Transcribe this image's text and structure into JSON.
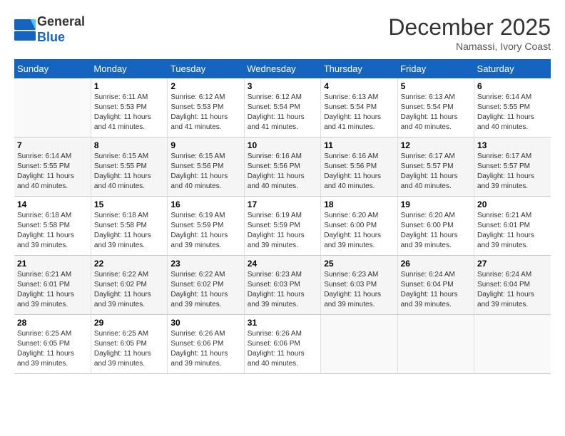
{
  "header": {
    "logo_line1": "General",
    "logo_line2": "Blue",
    "month": "December 2025",
    "location": "Namassi, Ivory Coast"
  },
  "weekdays": [
    "Sunday",
    "Monday",
    "Tuesday",
    "Wednesday",
    "Thursday",
    "Friday",
    "Saturday"
  ],
  "weeks": [
    [
      {
        "day": "",
        "sunrise": "",
        "sunset": "",
        "daylight": "",
        "empty": true
      },
      {
        "day": "1",
        "sunrise": "Sunrise: 6:11 AM",
        "sunset": "Sunset: 5:53 PM",
        "daylight": "Daylight: 11 hours and 41 minutes.",
        "empty": false
      },
      {
        "day": "2",
        "sunrise": "Sunrise: 6:12 AM",
        "sunset": "Sunset: 5:53 PM",
        "daylight": "Daylight: 11 hours and 41 minutes.",
        "empty": false
      },
      {
        "day": "3",
        "sunrise": "Sunrise: 6:12 AM",
        "sunset": "Sunset: 5:54 PM",
        "daylight": "Daylight: 11 hours and 41 minutes.",
        "empty": false
      },
      {
        "day": "4",
        "sunrise": "Sunrise: 6:13 AM",
        "sunset": "Sunset: 5:54 PM",
        "daylight": "Daylight: 11 hours and 41 minutes.",
        "empty": false
      },
      {
        "day": "5",
        "sunrise": "Sunrise: 6:13 AM",
        "sunset": "Sunset: 5:54 PM",
        "daylight": "Daylight: 11 hours and 40 minutes.",
        "empty": false
      },
      {
        "day": "6",
        "sunrise": "Sunrise: 6:14 AM",
        "sunset": "Sunset: 5:55 PM",
        "daylight": "Daylight: 11 hours and 40 minutes.",
        "empty": false
      }
    ],
    [
      {
        "day": "7",
        "sunrise": "Sunrise: 6:14 AM",
        "sunset": "Sunset: 5:55 PM",
        "daylight": "Daylight: 11 hours and 40 minutes.",
        "empty": false
      },
      {
        "day": "8",
        "sunrise": "Sunrise: 6:15 AM",
        "sunset": "Sunset: 5:55 PM",
        "daylight": "Daylight: 11 hours and 40 minutes.",
        "empty": false
      },
      {
        "day": "9",
        "sunrise": "Sunrise: 6:15 AM",
        "sunset": "Sunset: 5:56 PM",
        "daylight": "Daylight: 11 hours and 40 minutes.",
        "empty": false
      },
      {
        "day": "10",
        "sunrise": "Sunrise: 6:16 AM",
        "sunset": "Sunset: 5:56 PM",
        "daylight": "Daylight: 11 hours and 40 minutes.",
        "empty": false
      },
      {
        "day": "11",
        "sunrise": "Sunrise: 6:16 AM",
        "sunset": "Sunset: 5:56 PM",
        "daylight": "Daylight: 11 hours and 40 minutes.",
        "empty": false
      },
      {
        "day": "12",
        "sunrise": "Sunrise: 6:17 AM",
        "sunset": "Sunset: 5:57 PM",
        "daylight": "Daylight: 11 hours and 40 minutes.",
        "empty": false
      },
      {
        "day": "13",
        "sunrise": "Sunrise: 6:17 AM",
        "sunset": "Sunset: 5:57 PM",
        "daylight": "Daylight: 11 hours and 39 minutes.",
        "empty": false
      }
    ],
    [
      {
        "day": "14",
        "sunrise": "Sunrise: 6:18 AM",
        "sunset": "Sunset: 5:58 PM",
        "daylight": "Daylight: 11 hours and 39 minutes.",
        "empty": false
      },
      {
        "day": "15",
        "sunrise": "Sunrise: 6:18 AM",
        "sunset": "Sunset: 5:58 PM",
        "daylight": "Daylight: 11 hours and 39 minutes.",
        "empty": false
      },
      {
        "day": "16",
        "sunrise": "Sunrise: 6:19 AM",
        "sunset": "Sunset: 5:59 PM",
        "daylight": "Daylight: 11 hours and 39 minutes.",
        "empty": false
      },
      {
        "day": "17",
        "sunrise": "Sunrise: 6:19 AM",
        "sunset": "Sunset: 5:59 PM",
        "daylight": "Daylight: 11 hours and 39 minutes.",
        "empty": false
      },
      {
        "day": "18",
        "sunrise": "Sunrise: 6:20 AM",
        "sunset": "Sunset: 6:00 PM",
        "daylight": "Daylight: 11 hours and 39 minutes.",
        "empty": false
      },
      {
        "day": "19",
        "sunrise": "Sunrise: 6:20 AM",
        "sunset": "Sunset: 6:00 PM",
        "daylight": "Daylight: 11 hours and 39 minutes.",
        "empty": false
      },
      {
        "day": "20",
        "sunrise": "Sunrise: 6:21 AM",
        "sunset": "Sunset: 6:01 PM",
        "daylight": "Daylight: 11 hours and 39 minutes.",
        "empty": false
      }
    ],
    [
      {
        "day": "21",
        "sunrise": "Sunrise: 6:21 AM",
        "sunset": "Sunset: 6:01 PM",
        "daylight": "Daylight: 11 hours and 39 minutes.",
        "empty": false
      },
      {
        "day": "22",
        "sunrise": "Sunrise: 6:22 AM",
        "sunset": "Sunset: 6:02 PM",
        "daylight": "Daylight: 11 hours and 39 minutes.",
        "empty": false
      },
      {
        "day": "23",
        "sunrise": "Sunrise: 6:22 AM",
        "sunset": "Sunset: 6:02 PM",
        "daylight": "Daylight: 11 hours and 39 minutes.",
        "empty": false
      },
      {
        "day": "24",
        "sunrise": "Sunrise: 6:23 AM",
        "sunset": "Sunset: 6:03 PM",
        "daylight": "Daylight: 11 hours and 39 minutes.",
        "empty": false
      },
      {
        "day": "25",
        "sunrise": "Sunrise: 6:23 AM",
        "sunset": "Sunset: 6:03 PM",
        "daylight": "Daylight: 11 hours and 39 minutes.",
        "empty": false
      },
      {
        "day": "26",
        "sunrise": "Sunrise: 6:24 AM",
        "sunset": "Sunset: 6:04 PM",
        "daylight": "Daylight: 11 hours and 39 minutes.",
        "empty": false
      },
      {
        "day": "27",
        "sunrise": "Sunrise: 6:24 AM",
        "sunset": "Sunset: 6:04 PM",
        "daylight": "Daylight: 11 hours and 39 minutes.",
        "empty": false
      }
    ],
    [
      {
        "day": "28",
        "sunrise": "Sunrise: 6:25 AM",
        "sunset": "Sunset: 6:05 PM",
        "daylight": "Daylight: 11 hours and 39 minutes.",
        "empty": false
      },
      {
        "day": "29",
        "sunrise": "Sunrise: 6:25 AM",
        "sunset": "Sunset: 6:05 PM",
        "daylight": "Daylight: 11 hours and 39 minutes.",
        "empty": false
      },
      {
        "day": "30",
        "sunrise": "Sunrise: 6:26 AM",
        "sunset": "Sunset: 6:06 PM",
        "daylight": "Daylight: 11 hours and 39 minutes.",
        "empty": false
      },
      {
        "day": "31",
        "sunrise": "Sunrise: 6:26 AM",
        "sunset": "Sunset: 6:06 PM",
        "daylight": "Daylight: 11 hours and 40 minutes.",
        "empty": false
      },
      {
        "day": "",
        "sunrise": "",
        "sunset": "",
        "daylight": "",
        "empty": true
      },
      {
        "day": "",
        "sunrise": "",
        "sunset": "",
        "daylight": "",
        "empty": true
      },
      {
        "day": "",
        "sunrise": "",
        "sunset": "",
        "daylight": "",
        "empty": true
      }
    ]
  ]
}
